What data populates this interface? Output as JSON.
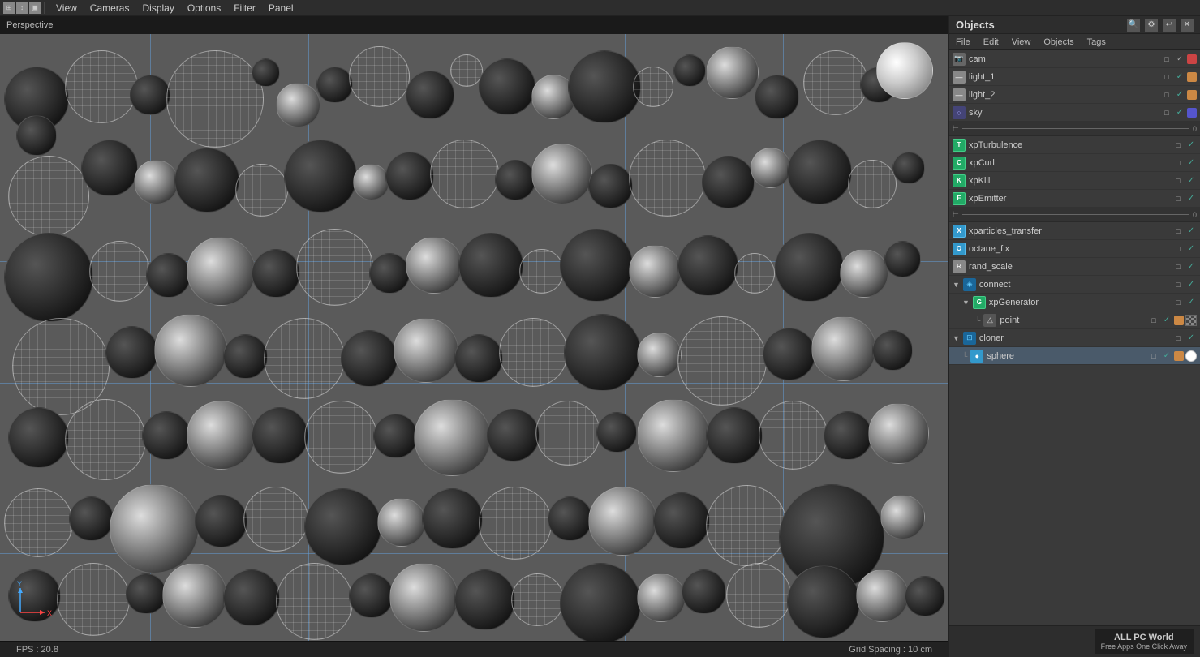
{
  "menubar": {
    "icons": [
      "⊞",
      "↕",
      "🔲"
    ],
    "items": [
      "View",
      "Cameras",
      "Display",
      "Options",
      "Filter",
      "Panel"
    ]
  },
  "viewport": {
    "label": "Perspective",
    "fps_label": "FPS : 20.8",
    "grid_spacing_label": "Grid Spacing : 10 cm"
  },
  "panel": {
    "title": "Objects",
    "menu_items": [
      "File",
      "Edit",
      "View",
      "Objects",
      "Tags"
    ],
    "icons": [
      "🔍",
      "⚙",
      "↩",
      "✕"
    ]
  },
  "objects": [
    {
      "id": "cam",
      "name": "cam",
      "indent": 0,
      "icon_color": "#888",
      "icon_char": "📷",
      "dot_color": "#c44",
      "has_check": true,
      "separator": false
    },
    {
      "id": "light_1",
      "name": "light_1",
      "indent": 0,
      "icon_color": "#888",
      "icon_char": "—",
      "dot_color": "#c84",
      "has_check": true,
      "separator": false
    },
    {
      "id": "light_2",
      "name": "light_2",
      "indent": 0,
      "icon_color": "#888",
      "icon_char": "—",
      "dot_color": "#c84",
      "has_check": true,
      "separator": false
    },
    {
      "id": "sky",
      "name": "sky",
      "indent": 0,
      "icon_color": "#888",
      "icon_char": "○",
      "dot_color": "#55c",
      "has_check": true,
      "separator": false
    },
    {
      "id": "sep1",
      "name": "——————————————",
      "indent": 0,
      "icon_color": "#666",
      "icon_char": "⊢",
      "separator": true
    },
    {
      "id": "xpTurbulence",
      "name": "xpTurbulence",
      "indent": 0,
      "icon_color": "#4a4",
      "icon_char": "T",
      "dot_color": "#4a4",
      "has_check": true,
      "separator": false
    },
    {
      "id": "xpCurl",
      "name": "xpCurl",
      "indent": 0,
      "icon_color": "#4a4",
      "icon_char": "C",
      "dot_color": "#4a4",
      "has_check": true,
      "separator": false
    },
    {
      "id": "xpKill",
      "name": "xpKill",
      "indent": 0,
      "icon_color": "#4a4",
      "icon_char": "K",
      "dot_color": "#4a4",
      "has_check": true,
      "separator": false
    },
    {
      "id": "xpEmitter",
      "name": "xpEmitter",
      "indent": 0,
      "icon_color": "#4a4",
      "icon_char": "E",
      "dot_color": "#4a4",
      "has_check": true,
      "separator": false
    },
    {
      "id": "sep2",
      "name": "——————————————",
      "indent": 0,
      "icon_color": "#666",
      "icon_char": "⊢",
      "separator": true
    },
    {
      "id": "xparticles_transfer",
      "name": "xparticles_transfer",
      "indent": 0,
      "icon_color": "#5af",
      "icon_char": "X",
      "dot_color": "#4a4",
      "has_check": true,
      "separator": false
    },
    {
      "id": "octane_fix",
      "name": "octane_fix",
      "indent": 0,
      "icon_color": "#5af",
      "icon_char": "O",
      "dot_color": "#4a4",
      "has_check": true,
      "separator": false
    },
    {
      "id": "rand_scale",
      "name": "rand_scale",
      "indent": 0,
      "icon_color": "#aaa",
      "icon_char": "R",
      "dot_color": "#4a4",
      "has_check": true,
      "separator": false
    },
    {
      "id": "connect",
      "name": "connect",
      "indent": 0,
      "icon_color": "#4af",
      "icon_char": "◈",
      "dot_color": "#4a4",
      "has_check": true,
      "separator": false,
      "expanded": true
    },
    {
      "id": "xpGenerator",
      "name": "xpGenerator",
      "indent": 1,
      "icon_color": "#4a4",
      "icon_char": "G",
      "dot_color": "#4a4",
      "has_check": true,
      "separator": false,
      "expanded": true
    },
    {
      "id": "point",
      "name": "point",
      "indent": 2,
      "icon_color": "#aaa",
      "icon_char": "△",
      "dot_color": "#c84",
      "has_check": true,
      "separator": false
    },
    {
      "id": "cloner",
      "name": "cloner",
      "indent": 0,
      "icon_color": "#4af",
      "icon_char": "⊡",
      "dot_color": "#4a4",
      "has_check": true,
      "separator": false,
      "expanded": true
    },
    {
      "id": "sphere",
      "name": "sphere",
      "indent": 1,
      "icon_color": "#5af",
      "icon_char": "●",
      "dot_color": "#c84",
      "has_check": true,
      "separator": false
    }
  ],
  "axes": {
    "x_label": "X",
    "y_label": "Y"
  },
  "watermark": {
    "line1": "ALL PC World",
    "line2": "Free Apps One Click Away"
  }
}
